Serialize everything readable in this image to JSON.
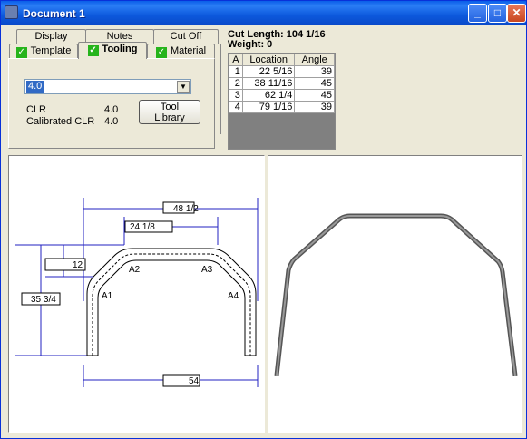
{
  "window": {
    "title": "Document 1"
  },
  "tabs": {
    "row_back": [
      "Display",
      "Notes",
      "Cut Off"
    ],
    "row_front": [
      "Template",
      "Tooling",
      "Material"
    ],
    "selected": "Tooling"
  },
  "tooling": {
    "dropdown_value": "4.0",
    "clr_label": "CLR",
    "clr_value": "4.0",
    "calibrated_clr_label": "Calibrated CLR",
    "calibrated_clr_value": "4.0",
    "tool_library_button": "Tool Library"
  },
  "summary": {
    "cut_length": "Cut Length: 104  1/16",
    "weight": "Weight: 0"
  },
  "bend_table": {
    "headers": [
      "A",
      "Location",
      "Angle"
    ],
    "rows": [
      [
        "1",
        "22  5/16",
        "39"
      ],
      [
        "2",
        "38  11/16",
        "45"
      ],
      [
        "3",
        "62  1/4",
        "45"
      ],
      [
        "4",
        "79  1/16",
        "39"
      ]
    ]
  },
  "drawing": {
    "dim_top_outer": "48 1/2",
    "dim_top_inner": "24 1/8",
    "dim_side_small": "12",
    "dim_side_total": "35 3/4",
    "dim_bottom": "54",
    "bend_labels": [
      "A1",
      "A2",
      "A3",
      "A4"
    ],
    "line_color": "#2020c0"
  },
  "colors": {
    "titlebar": "#0a5ee8",
    "checkmark": "#26b41c",
    "selection": "#316ac5"
  }
}
